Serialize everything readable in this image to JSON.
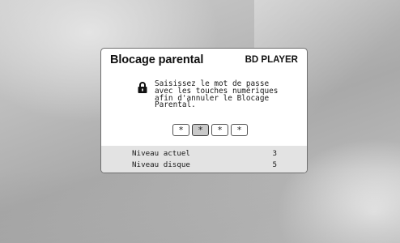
{
  "dialog": {
    "title": "Blocage parental",
    "device_label": "BD PLAYER",
    "message_lines": [
      "Saisissez le mot de passe",
      "avec les touches numériques",
      "afin d'annuler le Blocage",
      "Parental."
    ],
    "password_digits": [
      "*",
      "*",
      "*",
      "*"
    ],
    "active_digit_index": 1
  },
  "info": {
    "current_level_label": "Niveau actuel",
    "current_level_value": "3",
    "disc_level_label": "Niveau disque",
    "disc_level_value": "5"
  },
  "icons": {
    "lock": "lock-icon"
  },
  "colors": {
    "dialog_bg": "#ffffff",
    "info_bg": "#e3e3e3",
    "active_digit_bg": "#c9c9c9"
  }
}
